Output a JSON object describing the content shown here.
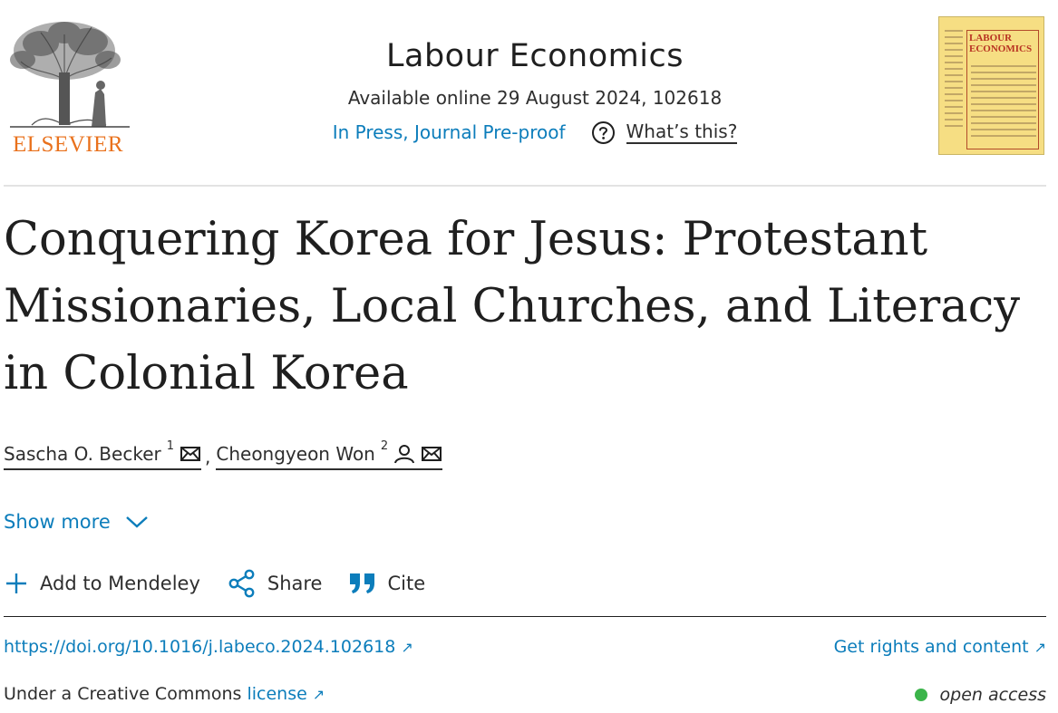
{
  "header": {
    "publisher_logo_text": "ELSEVIER",
    "journal_title": "Labour Economics",
    "availability": "Available online 29 August 2024, 102618",
    "status": "In Press, Journal Pre-proof",
    "whats_this": "What’s this?",
    "cover_title": "LABOUR ECONOMICS"
  },
  "article": {
    "title": "Conquering Korea for Jesus: Protestant Missionaries, Local Churches, and Literacy in Colonial Korea"
  },
  "authors": [
    {
      "name": "Sascha O. Becker",
      "sup": "1"
    },
    {
      "name": "Cheongyeon Won",
      "sup": "2"
    }
  ],
  "author_separator": ",",
  "show_more": "Show more",
  "actions": {
    "mendeley": "Add to Mendeley",
    "share": "Share",
    "cite": "Cite"
  },
  "links": {
    "doi": "https://doi.org/10.1016/j.labeco.2024.102618",
    "rights": "Get rights and content",
    "arrow": "↗"
  },
  "license": {
    "prefix": "Under a Creative Commons",
    "link": "license",
    "access": "open access"
  },
  "colors": {
    "link": "#0c7dbb",
    "elsevier_orange": "#e9711c",
    "open_access_dot": "#3bb44a",
    "cover": "#f6de83"
  },
  "icons": [
    "help-circle-icon",
    "mail-icon",
    "person-icon",
    "chevron-down-icon",
    "plus-icon",
    "share-icon",
    "quote-icon",
    "external-arrow-icon"
  ]
}
